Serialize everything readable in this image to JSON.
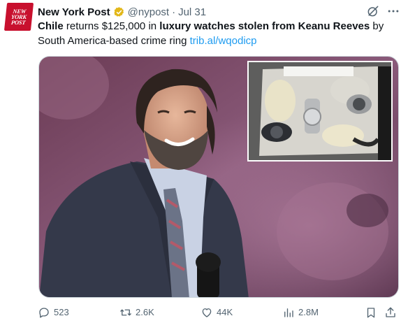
{
  "account": {
    "avatar_lines": [
      "NEW",
      "YORK",
      "POST"
    ],
    "name": "New York Post",
    "handle": "@nypost",
    "separator": "·",
    "date": "Jul 31"
  },
  "tweet": {
    "segments": [
      {
        "text": "Chile",
        "bold": true
      },
      {
        "text": " returns $125,000 in ",
        "bold": false
      },
      {
        "text": "luxury watches stolen from Keanu Reeves",
        "bold": true
      },
      {
        "text": " by South America-based crime ring ",
        "bold": false
      }
    ],
    "link": "trib.al/wqodicp"
  },
  "media": {
    "main_photo": "man-smiling-in-suit-photo",
    "inset_photo": "evidence-bag-watches-photo"
  },
  "actions": {
    "replies": "523",
    "reposts": "2.6K",
    "likes": "44K",
    "views": "2.8M"
  },
  "icons": [
    "verified-badge-icon",
    "grok-icon",
    "more-icon",
    "reply-icon",
    "repost-icon",
    "like-icon",
    "views-icon",
    "bookmark-icon",
    "share-icon"
  ],
  "colors": {
    "accent": "#1d9bf0",
    "brand_red": "#c8102e",
    "verified_gold": "#e2b719",
    "text_secondary": "#536471"
  }
}
